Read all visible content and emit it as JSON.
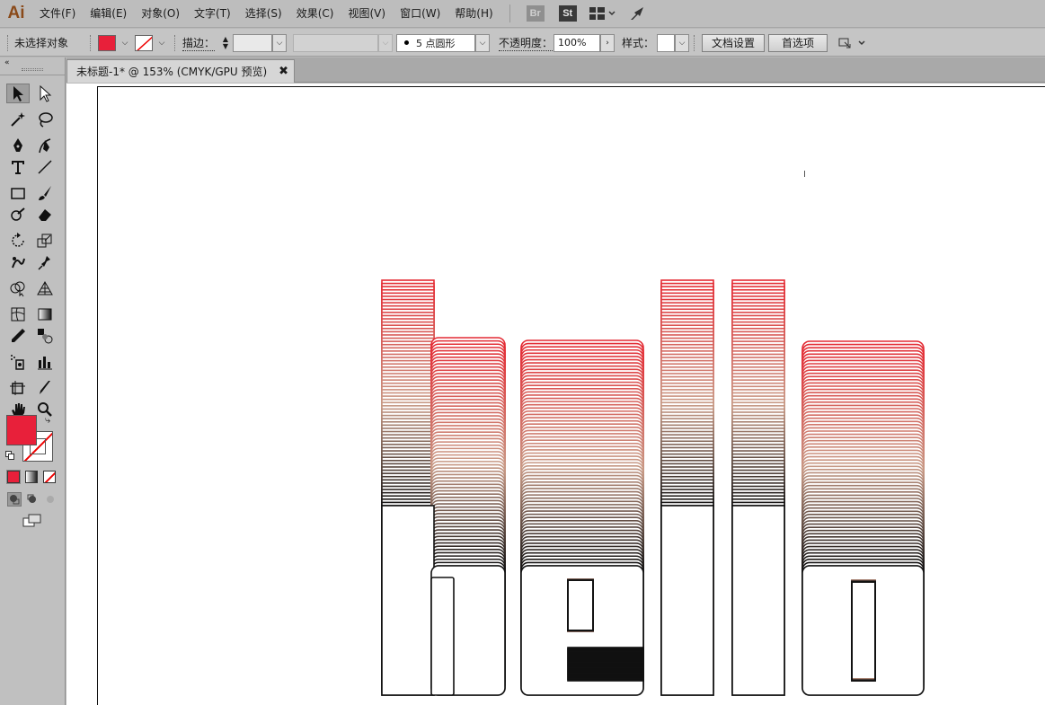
{
  "app": {
    "logo": "Ai"
  },
  "menu": {
    "items": [
      "文件(F)",
      "编辑(E)",
      "对象(O)",
      "文字(T)",
      "选择(S)",
      "效果(C)",
      "视图(V)",
      "窗口(W)",
      "帮助(H)"
    ],
    "br": "Br",
    "st": "St"
  },
  "control": {
    "selection_status": "未选择对象",
    "fill_color": "#e8203a",
    "stroke_label": "描边：",
    "brush_label": "5 点圆形",
    "opacity_label": "不透明度：",
    "opacity_value": "100%",
    "style_label": "样式：",
    "doc_setup": "文档设置",
    "preferences": "首选项"
  },
  "tab": {
    "title": "未标题-1* @ 153% (CMYK/GPU 预览)",
    "close": "✖"
  },
  "colors": {
    "accent_red": "#e8203a",
    "artwork_top": "#e42a33",
    "artwork_mid": "#c89a86",
    "artwork_dark": "#111111"
  },
  "toolbox": {
    "fill_color": "#e8203a",
    "tools": [
      "selection-tool-icon",
      "direct-selection-tool-icon",
      "magic-wand-tool-icon",
      "lasso-tool-icon",
      "pen-tool-icon",
      "curvature-tool-icon",
      "type-tool-icon",
      "line-tool-icon",
      "rectangle-tool-icon",
      "paintbrush-tool-icon",
      "shaper-tool-icon",
      "eraser-tool-icon",
      "rotate-tool-icon",
      "scale-tool-icon",
      "warp-tool-icon",
      "puppet-warp-tool-icon",
      "shape-builder-tool-icon",
      "perspective-grid-tool-icon",
      "mesh-tool-icon",
      "gradient-tool-icon",
      "eyedropper-tool-icon",
      "blend-tool-icon",
      "symbol-sprayer-tool-icon",
      "column-graph-tool-icon",
      "artboard-tool-icon",
      "slice-tool-icon",
      "hand-tool-icon",
      "zoom-tool-icon"
    ]
  }
}
